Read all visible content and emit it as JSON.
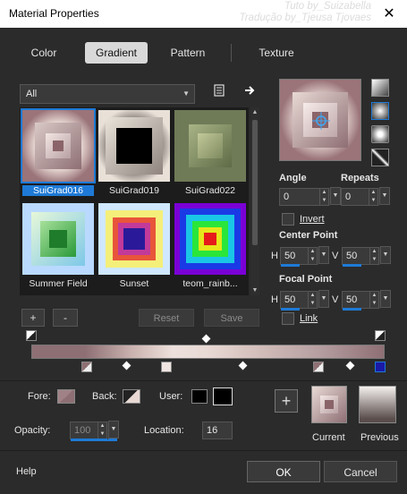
{
  "window": {
    "title": "Material Properties",
    "watermark_line1": "Tuto by_Suizabella",
    "watermark_line2": "Tradução by_Tjeusa Tjovaes",
    "close_glyph": "✕"
  },
  "tabs": [
    {
      "label": "Color",
      "active": false
    },
    {
      "label": "Gradient",
      "active": true
    },
    {
      "label": "Pattern",
      "active": false
    },
    {
      "label": "Texture",
      "active": false
    }
  ],
  "category_dropdown": {
    "value": "All"
  },
  "gradients": [
    {
      "label": "SuiGrad016",
      "selected": true
    },
    {
      "label": "SuiGrad019",
      "selected": false
    },
    {
      "label": "SuiGrad022",
      "selected": false
    },
    {
      "label": "Summer Field",
      "selected": false
    },
    {
      "label": "Sunset",
      "selected": false
    },
    {
      "label": "teom_rainb...",
      "selected": false
    }
  ],
  "list_buttons": {
    "add": "+",
    "remove": "-",
    "reset": "Reset",
    "save": "Save"
  },
  "angle": {
    "label": "Angle",
    "value": "0"
  },
  "repeats": {
    "label": "Repeats",
    "value": "0"
  },
  "invert": {
    "label": "Invert",
    "checked": false
  },
  "center_point": {
    "label": "Center Point",
    "h_label": "H",
    "h_value": "50",
    "v_label": "V",
    "v_value": "50"
  },
  "focal_point": {
    "label": "Focal Point",
    "h_label": "H",
    "h_value": "50",
    "v_label": "V",
    "v_value": "50"
  },
  "link": {
    "label": "Link",
    "checked": false
  },
  "colors": {
    "fore_label": "Fore:",
    "back_label": "Back:",
    "user_label": "User:",
    "opacity_label": "Opacity:",
    "opacity_value": "100",
    "location_label": "Location:",
    "location_value": "16",
    "current_label": "Current",
    "previous_label": "Previous",
    "add_swatch": "+"
  },
  "footer": {
    "help": "Help",
    "ok": "OK",
    "cancel": "Cancel"
  },
  "palette": {
    "accent": "#1e7ad6",
    "grad_mauve": "#8e6f74",
    "grad_light": "#e8d9d4",
    "bg": "#2b2b2b"
  }
}
